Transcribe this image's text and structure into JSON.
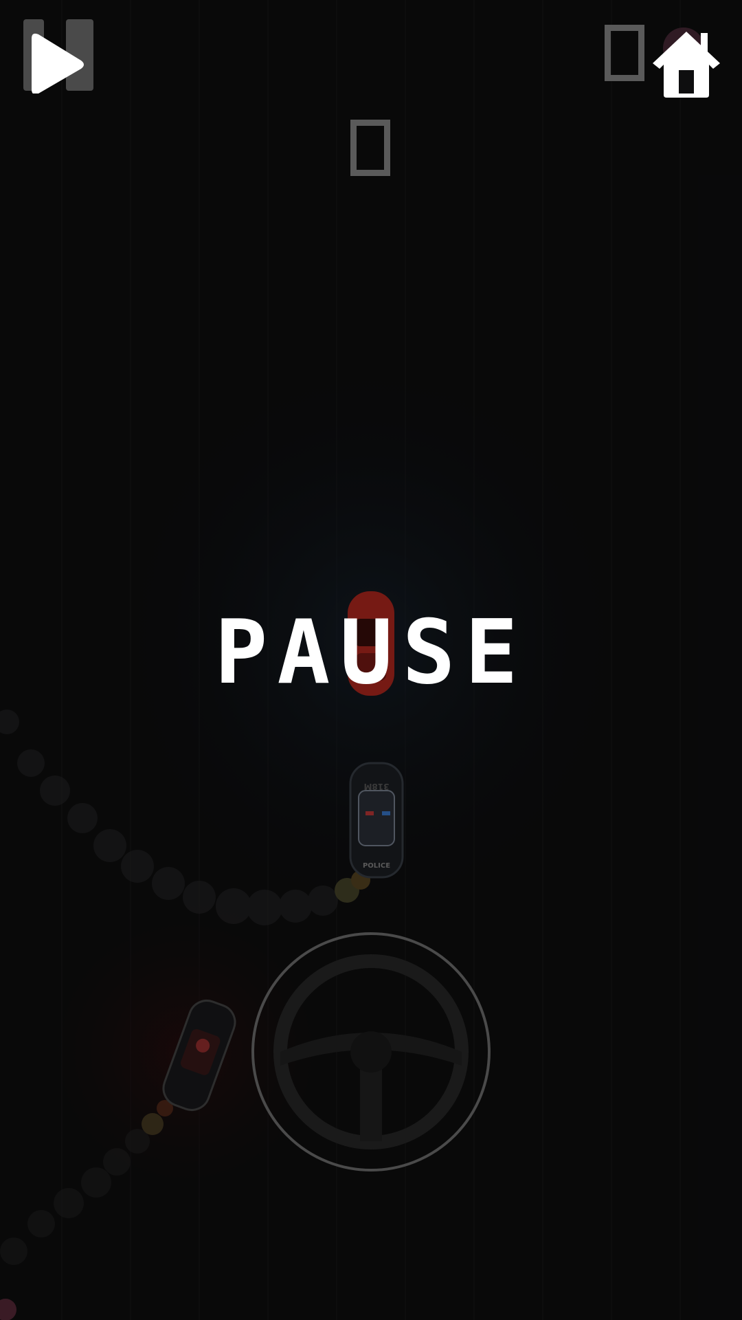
{
  "hud": {
    "score": "0",
    "coins": "0",
    "pause_icon": "pause-icon",
    "play_icon": "play-icon",
    "home_icon": "home-icon"
  },
  "overlay": {
    "title": "PAUSE"
  },
  "scene": {
    "player_car_color": "#c0392b",
    "police_car_label": "POLICE",
    "police_roof_label": "318M",
    "steering_wheel_icon": "steering-wheel-icon"
  },
  "colors": {
    "background": "#0e0e0f",
    "text": "#ffffff",
    "hud_gray": "#5a5a5a"
  }
}
